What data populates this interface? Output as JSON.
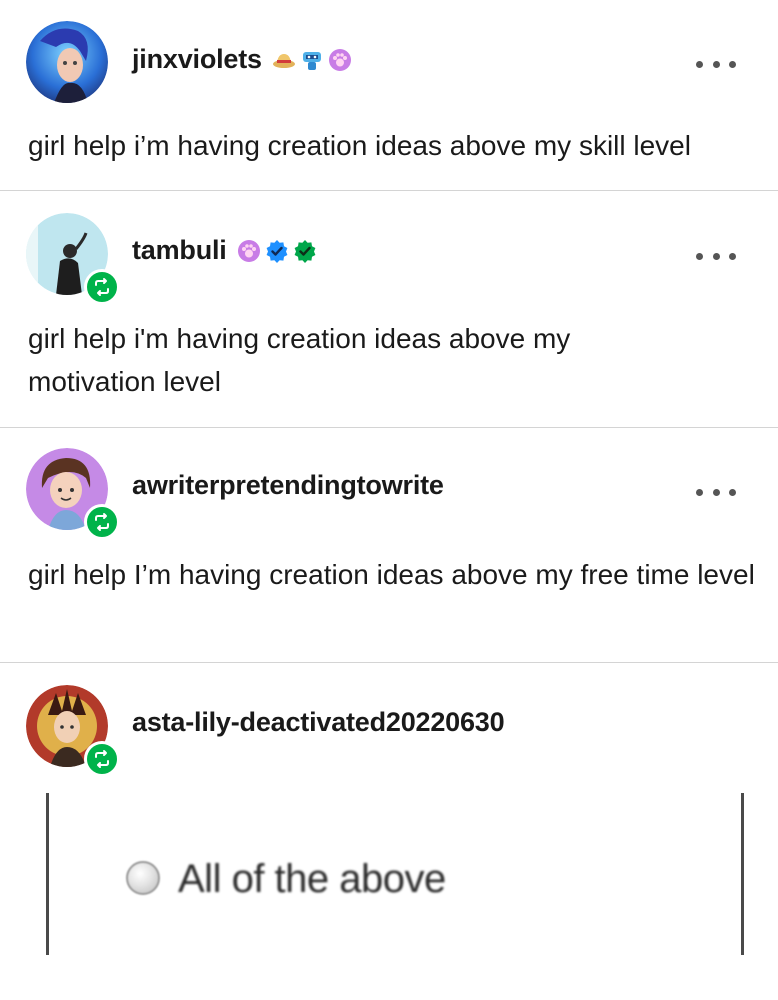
{
  "posts": [
    {
      "username": "jinxviolets",
      "badges": [
        "straw-hat-icon",
        "robot-icon",
        "paw-badge-icon"
      ],
      "text": "girl help i’m having creation ideas above my skill level",
      "reblogged": false
    },
    {
      "username": "tambuli",
      "badges": [
        "paw-badge-icon",
        "blue-verified-icon",
        "green-verified-icon"
      ],
      "text": "girl help i'm having creation ideas above my motivation level",
      "reblogged": true
    },
    {
      "username": "awriterpretendingtowrite",
      "badges": [],
      "text": "girl help I’m having creation ideas above my free time level",
      "reblogged": true
    },
    {
      "username": "asta-lily-deactivated20220630",
      "badges": [],
      "image_option_label": "All of the above",
      "reblogged": true
    }
  ],
  "colors": {
    "reblog_green": "#00b34a",
    "divider": "#d4d4d4",
    "text": "#1a1a1a"
  }
}
